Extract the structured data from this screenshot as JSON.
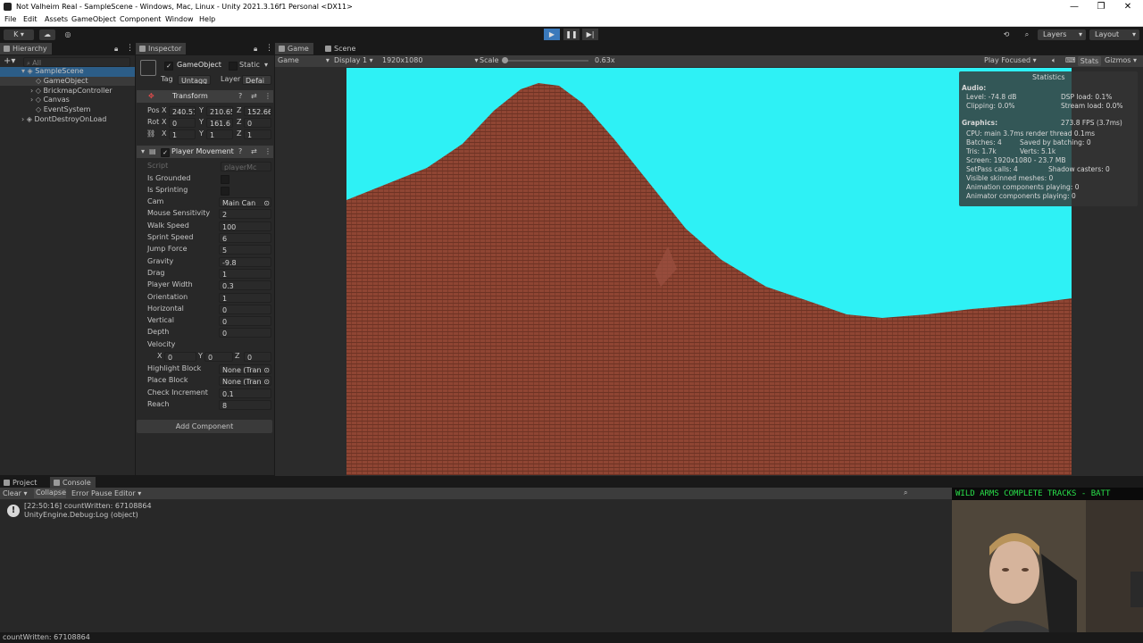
{
  "window": {
    "title": "Not Valheim Real - SampleScene - Windows, Mac, Linux - Unity 2021.3.16f1 Personal <DX11>",
    "controls": [
      "—",
      "❐",
      "✕"
    ]
  },
  "menu": [
    "File",
    "Edit",
    "Assets",
    "GameObject",
    "Component",
    "Window",
    "Help"
  ],
  "toolbar": {
    "account": "K",
    "layers": "Layers",
    "layout": "Layout"
  },
  "hierarchy": {
    "tab": "Hierarchy",
    "search_placeholder": "All",
    "items": [
      {
        "label": "SampleScene",
        "indent": 0
      },
      {
        "label": "GameObject",
        "indent": 1
      },
      {
        "label": "BrickmapController",
        "indent": 1
      },
      {
        "label": "Canvas",
        "indent": 1
      },
      {
        "label": "EventSystem",
        "indent": 1
      },
      {
        "label": "DontDestroyOnLoad",
        "indent": 0
      }
    ]
  },
  "inspector": {
    "tab": "Inspector",
    "object_name": "GameObject",
    "static_label": "Static",
    "tag_label": "Tag",
    "tag_value": "Untagg",
    "layer_label": "Layer",
    "layer_value": "Defai",
    "transform": {
      "title": "Transform",
      "rows": [
        {
          "label": "Pos",
          "x": "240.57",
          "y": "210.65",
          "z": "152.66"
        },
        {
          "label": "Rot",
          "x": "0",
          "y": "161.6",
          "z": "0"
        },
        {
          "label": "",
          "x": "1",
          "y": "1",
          "z": "1"
        }
      ]
    },
    "player_movement": {
      "title": "Player Movement",
      "script_label": "Script",
      "script_value": "playerMc",
      "fields": [
        {
          "label": "Is Grounded",
          "value": "",
          "type": "bool"
        },
        {
          "label": "Is Sprinting",
          "value": "",
          "type": "bool"
        },
        {
          "label": "Cam",
          "value": "Main Can",
          "type": "object"
        },
        {
          "label": "Mouse Sensitivity",
          "value": "2",
          "type": "number"
        },
        {
          "label": "Walk Speed",
          "value": "100",
          "type": "number"
        },
        {
          "label": "Sprint Speed",
          "value": "6",
          "type": "number"
        },
        {
          "label": "Jump Force",
          "value": "5",
          "type": "number"
        },
        {
          "label": "Gravity",
          "value": "-9.8",
          "type": "number"
        },
        {
          "label": "Drag",
          "value": "1",
          "type": "number"
        },
        {
          "label": "Player Width",
          "value": "0.3",
          "type": "number"
        },
        {
          "label": "Orientation",
          "value": "1",
          "type": "number"
        },
        {
          "label": "Horizontal",
          "value": "0",
          "type": "number"
        },
        {
          "label": "Vertical",
          "value": "0",
          "type": "number"
        },
        {
          "label": "Depth",
          "value": "0",
          "type": "number"
        }
      ],
      "velocity_label": "Velocity",
      "velocity": {
        "x": "0",
        "y": "0",
        "z": "0"
      },
      "fields2": [
        {
          "label": "Highlight Block",
          "value": "None (Tran",
          "type": "object"
        },
        {
          "label": "Place Block",
          "value": "None (Tran",
          "type": "object"
        },
        {
          "label": "Check Increment",
          "value": "0.1",
          "type": "number"
        },
        {
          "label": "Reach",
          "value": "8",
          "type": "number"
        }
      ]
    },
    "add_component": "Add Component"
  },
  "game_view": {
    "tabs": [
      "Game",
      "Scene"
    ],
    "mode": "Game",
    "display": "Display 1",
    "resolution": "1920x1080",
    "scale_label": "Scale",
    "scale_value": "0.63x",
    "play_focused": "Play Focused",
    "stats_btn": "Stats",
    "gizmos": "Gizmos",
    "sky_color": "#2ef1f5",
    "terrain_color": "#8f4533"
  },
  "statistics": {
    "title": "Statistics",
    "audio_header": "Audio:",
    "level": "Level: -74.8 dB",
    "dsp": "DSP load: 0.1%",
    "clipping": "Clipping: 0.0%",
    "stream": "Stream load: 0.0%",
    "graphics_header": "Graphics:",
    "fps": "273.8 FPS (3.7ms)",
    "cpu": "CPU: main 3.7ms  render thread 0.1ms",
    "batches": "Batches: 4",
    "saved": "Saved by batching: 0",
    "tris": "Tris: 1.7k",
    "verts": "Verts: 5.1k",
    "screen": "Screen: 1920x1080 - 23.7 MB",
    "setpass": "SetPass calls: 4",
    "shadow": "Shadow casters: 0",
    "skinned": "Visible skinned meshes: 0",
    "anim": "Animation components playing: 0",
    "animator": "Animator components playing: 0"
  },
  "bottom": {
    "tabs": [
      "Project",
      "Console"
    ],
    "clear": "Clear",
    "collapse": "Collapse",
    "error_pause": "Error Pause",
    "editor": "Editor",
    "log_line1": "[22:50:16] countWritten: 67108864",
    "log_line2": "UnityEngine.Debug:Log (object)"
  },
  "ticker": "WILD ARMS COMPLETE TRACKS - BATT",
  "status_text": "countWritten: 67108864"
}
